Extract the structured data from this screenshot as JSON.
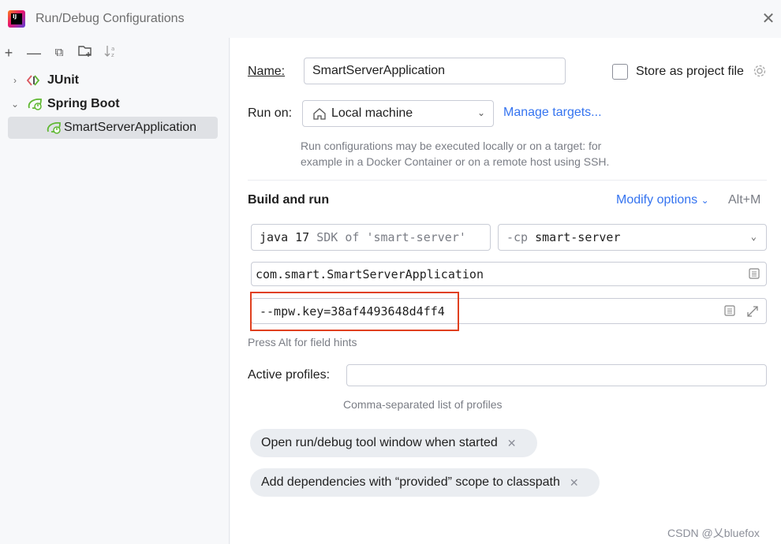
{
  "window": {
    "title": "Run/Debug Configurations",
    "app_icon_text": "IJ"
  },
  "toolbar": {
    "add": "+",
    "remove": "—",
    "copy": "⧉",
    "folder": "🗀",
    "sort": "↓ᵃ₂"
  },
  "tree": {
    "junit_label": "JUnit",
    "spring_boot_label": "Spring Boot",
    "app_label": "SmartServerApplication"
  },
  "form": {
    "name_label": "Name:",
    "name_value": "SmartServerApplication",
    "store_label": "Store as project file",
    "run_on_label": "Run on:",
    "run_on_value": "Local machine",
    "manage_targets": "Manage targets...",
    "run_hint_line1": "Run configurations may be executed locally or on a target: for",
    "run_hint_line2": "example in a Docker Container or on a remote host using SSH.",
    "build_and_run": "Build and run",
    "modify_options": "Modify options",
    "modify_shortcut": "Alt+M",
    "jdk_main": "java 17",
    "jdk_sub": "SDK of 'smart-server'",
    "cp_prefix": "-cp",
    "cp_value": "smart-server",
    "main_class": "com.smart.SmartServerApplication",
    "program_args": "--mpw.key=38af4493648d4ff4",
    "field_hint": "Press Alt for field hints",
    "active_profiles_label": "Active profiles:",
    "active_profiles_value": "",
    "profiles_hint": "Comma-separated list of profiles",
    "chip1": "Open run/debug tool window when started",
    "chip2": "Add dependencies with “provided” scope to classpath"
  },
  "watermark": "CSDN @乂bluefox",
  "colors": {
    "accent": "#3574f0",
    "highlight": "#e0401f",
    "spring": "#5fb832"
  }
}
